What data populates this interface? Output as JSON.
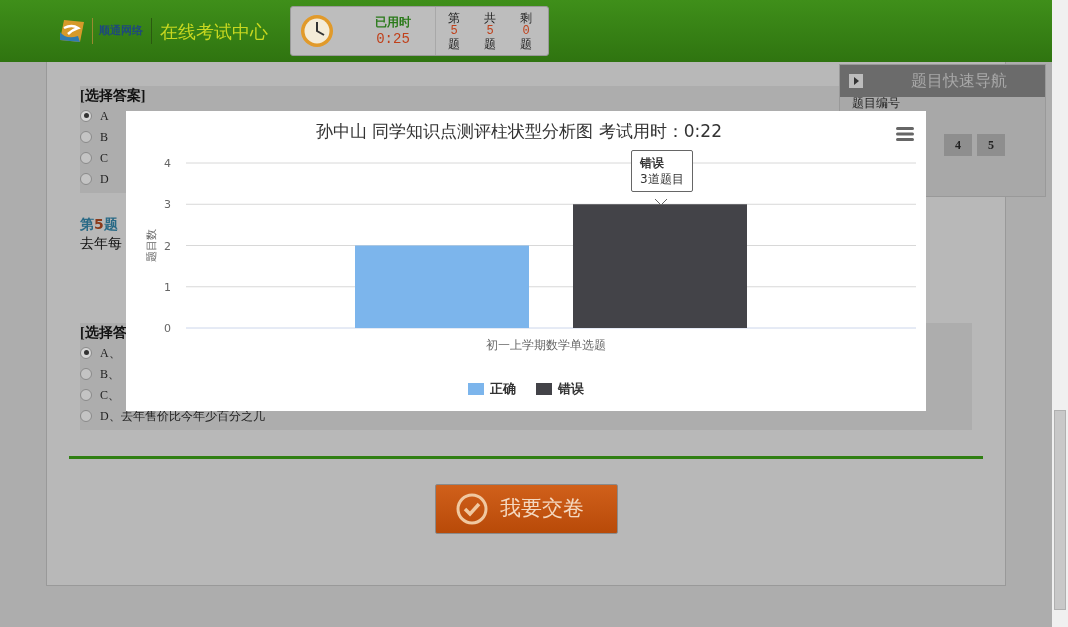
{
  "header": {
    "brand": "顺通网络",
    "title": "在线考试中心",
    "timer": {
      "label": "已用时",
      "value": "0:25"
    },
    "counters": [
      {
        "top": "第",
        "value": "5",
        "bottom": "题"
      },
      {
        "top": "共",
        "value": "5",
        "bottom": "题"
      },
      {
        "top": "剩",
        "value": "0",
        "bottom": "题"
      }
    ]
  },
  "questions": [
    {
      "answer_label": "[选择答案]",
      "options": [
        {
          "label": "A",
          "selected": true
        },
        {
          "label": "B",
          "selected": false
        },
        {
          "label": "C",
          "selected": false
        },
        {
          "label": "D",
          "selected": false
        }
      ]
    },
    {
      "heading_prefix": "第",
      "heading_number": "5",
      "heading_suffix": "题",
      "text": "去年每",
      "answer_label": "[选择答",
      "options": [
        {
          "label": "A、",
          "selected": true
        },
        {
          "label": "B、",
          "selected": false
        },
        {
          "label": "C、",
          "selected": false
        },
        {
          "label": "D、去年售价比今年少百分之几",
          "selected": false
        }
      ]
    }
  ],
  "submit_button": "我要交卷",
  "navigator": {
    "title": "题目快速导航",
    "subtitle": "题目编号",
    "numbers": [
      "4",
      "5"
    ]
  },
  "chart_popup": {
    "tooltip": {
      "series": "错误",
      "text": "3道题目"
    },
    "chart_data": {
      "type": "bar",
      "title": "孙中山 同学知识点测评柱状型分析图 考试用时：0:22",
      "ylabel": "题目数",
      "categories": [
        "初一上学期数学单选题"
      ],
      "ylim": [
        0,
        4
      ],
      "grid": true,
      "legend": true,
      "yticks": [
        0,
        1,
        2,
        3,
        4
      ],
      "series": [
        {
          "name": "正确",
          "color": "#7cb5ec",
          "values": [
            2
          ]
        },
        {
          "name": "错误",
          "color": "#434348",
          "values": [
            3
          ]
        }
      ]
    }
  }
}
